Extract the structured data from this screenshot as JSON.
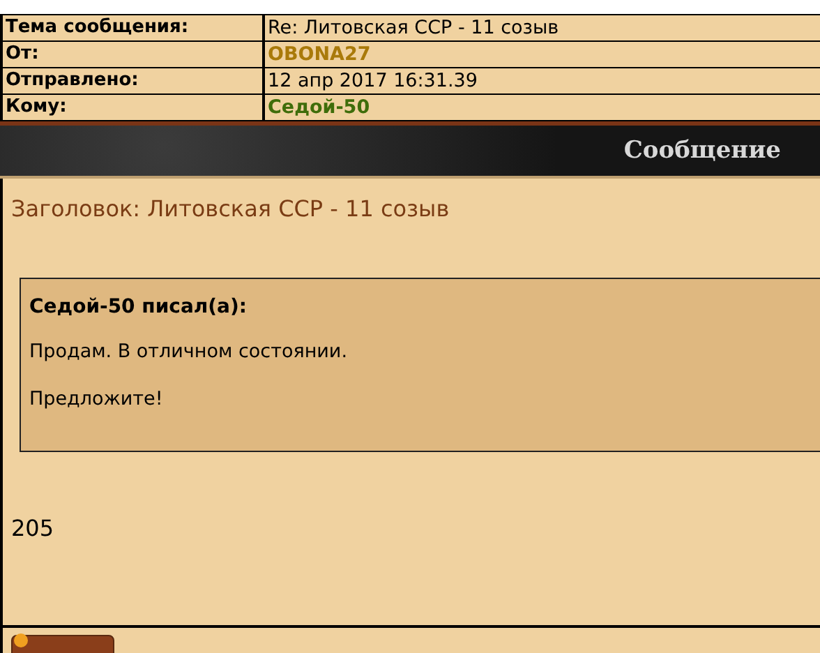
{
  "header_fields": [
    {
      "label": "Тема сообщения:",
      "value": "Re: Литовская ССР - 11 созыв",
      "kind": "plain"
    },
    {
      "label": "От:",
      "value": "OBONA27",
      "kind": "sender"
    },
    {
      "label": "Отправлено:",
      "value": "12 апр 2017 16:31.39",
      "kind": "plain"
    },
    {
      "label": "Кому:",
      "value": "Седой-50",
      "kind": "recipient"
    }
  ],
  "banner": {
    "title": "Сообщение"
  },
  "message": {
    "subject": "Заголовок: Литовская ССР - 11 созыв",
    "quote": {
      "author": "Седой-50 писал(а):",
      "lines": [
        "Продам. В отличном состоянии.",
        "Предложите!"
      ]
    },
    "body": "205"
  }
}
